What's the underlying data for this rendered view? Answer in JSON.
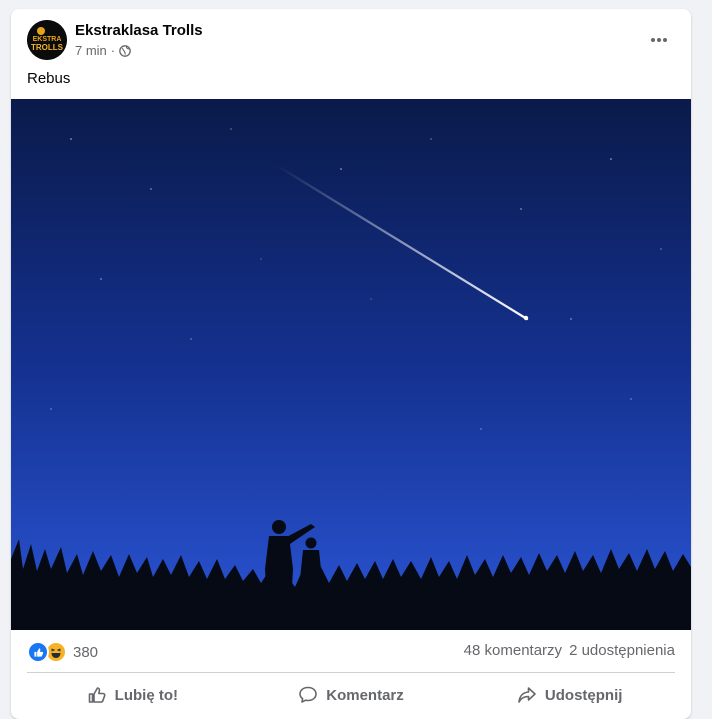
{
  "post": {
    "page_name": "Ekstraklasa Trolls",
    "time": "7 min",
    "separator": "·",
    "text": "Rebus",
    "avatar_text_top": "EKSTRA",
    "avatar_text_bottom": "TROLLS"
  },
  "icons": {
    "avatar": "page-logo",
    "globe": "globe-icon",
    "more": "more-options-icon",
    "like_reaction": "like-reaction-icon",
    "haha_reaction": "haha-reaction-icon",
    "like": "thumbs-up-icon",
    "comment": "comment-icon",
    "share": "share-icon"
  },
  "stats": {
    "reaction_count": "380",
    "comments": "48 komentarzy",
    "shares": "2 udostępnienia"
  },
  "actions": {
    "like_label": "Lubię to!",
    "comment_label": "Komentarz",
    "share_label": "Udostępnij"
  },
  "colors": {
    "accent": "#1877f2",
    "secondary_text": "#65676b",
    "sky_top": "#0a1a4a",
    "sky_bottom": "#2b55d6"
  }
}
